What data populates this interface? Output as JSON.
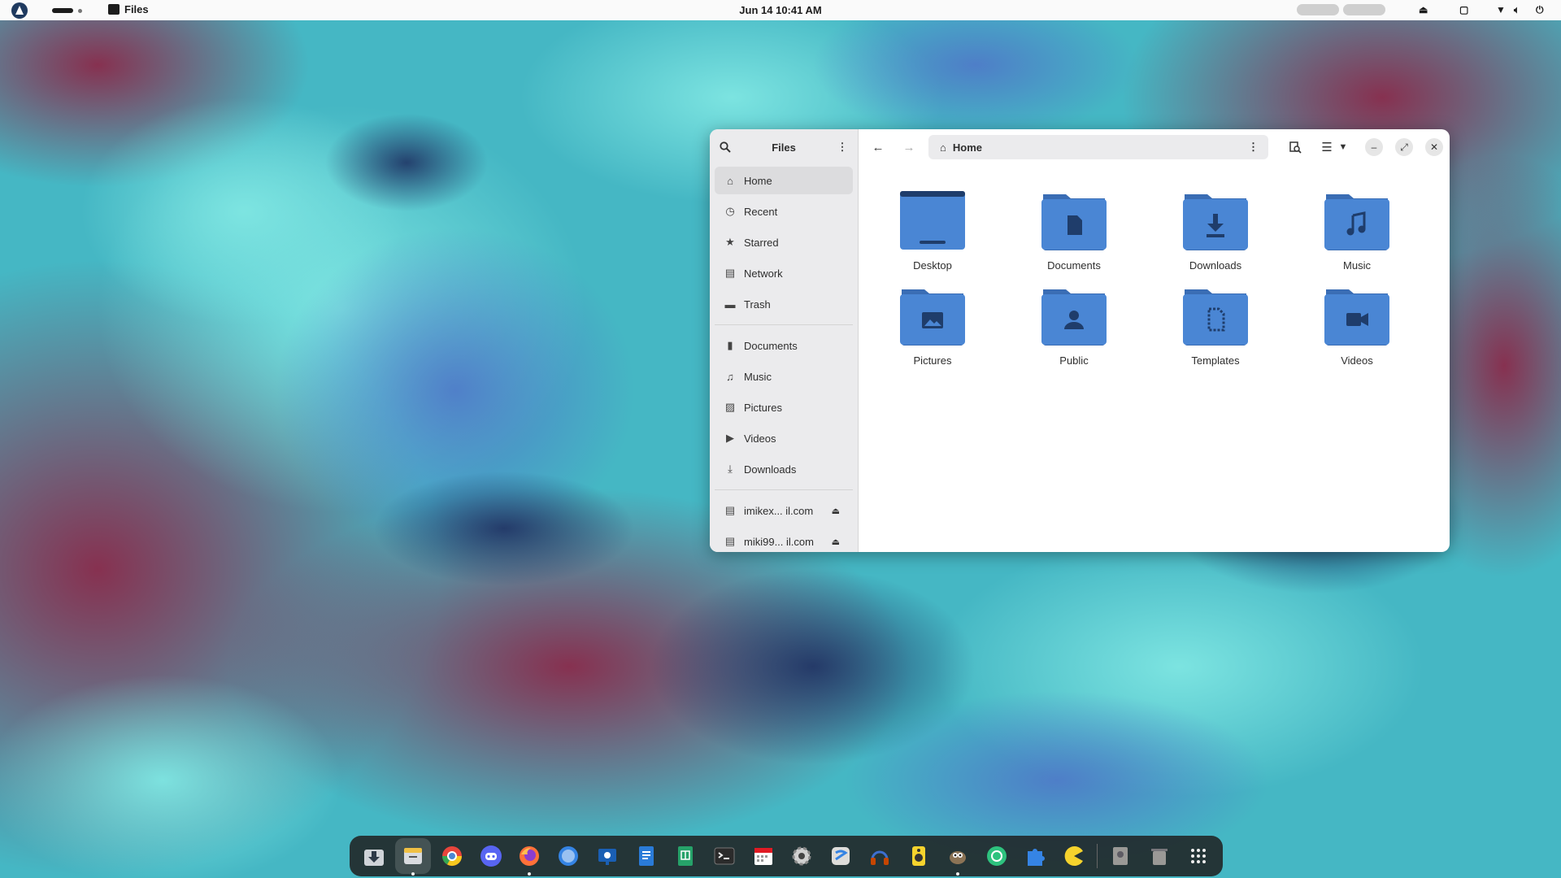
{
  "topbar": {
    "app_name": "Files",
    "clock": "Jun 14  10:41 AM"
  },
  "window": {
    "sidebar": {
      "title": "Files",
      "places": [
        {
          "label": "Home",
          "icon": "home-icon",
          "active": true
        },
        {
          "label": "Recent",
          "icon": "clock-icon"
        },
        {
          "label": "Starred",
          "icon": "star-icon"
        },
        {
          "label": "Network",
          "icon": "network-icon"
        },
        {
          "label": "Trash",
          "icon": "trash-icon"
        }
      ],
      "bookmarks": [
        {
          "label": "Documents",
          "icon": "document-icon"
        },
        {
          "label": "Music",
          "icon": "music-icon"
        },
        {
          "label": "Pictures",
          "icon": "picture-icon"
        },
        {
          "label": "Videos",
          "icon": "video-icon"
        },
        {
          "label": "Downloads",
          "icon": "download-icon"
        }
      ],
      "mounts": [
        {
          "label": "imikex...  il.com"
        },
        {
          "label": "miki99...  il.com"
        }
      ]
    },
    "path": {
      "location": "Home"
    },
    "folders": [
      {
        "label": "Desktop",
        "icon": "desktop-icon"
      },
      {
        "label": "Documents",
        "icon": "document-icon"
      },
      {
        "label": "Downloads",
        "icon": "download-icon"
      },
      {
        "label": "Music",
        "icon": "music-icon"
      },
      {
        "label": "Pictures",
        "icon": "picture-icon"
      },
      {
        "label": "Public",
        "icon": "person-icon"
      },
      {
        "label": "Templates",
        "icon": "template-icon"
      },
      {
        "label": "Videos",
        "icon": "video-icon"
      }
    ]
  },
  "colors": {
    "folder": "#4a86d4",
    "folder_tab": "#3a6db4",
    "folder_glyph": "#1f3d6b"
  },
  "dock": {
    "apps": [
      "downloads-icon",
      "files-icon",
      "chromium-icon",
      "discord-icon",
      "firefox-icon",
      "web-browser-icon",
      "presentation-icon",
      "writer-icon",
      "calc-icon",
      "terminal-icon",
      "calendar-icon",
      "settings-icon",
      "software-icon",
      "headphones-icon",
      "speaker-icon",
      "gimp-icon",
      "tor-icon",
      "extensions-icon",
      "pacman-icon",
      "disk-icon",
      "trash-icon",
      "app-grid-icon"
    ]
  }
}
